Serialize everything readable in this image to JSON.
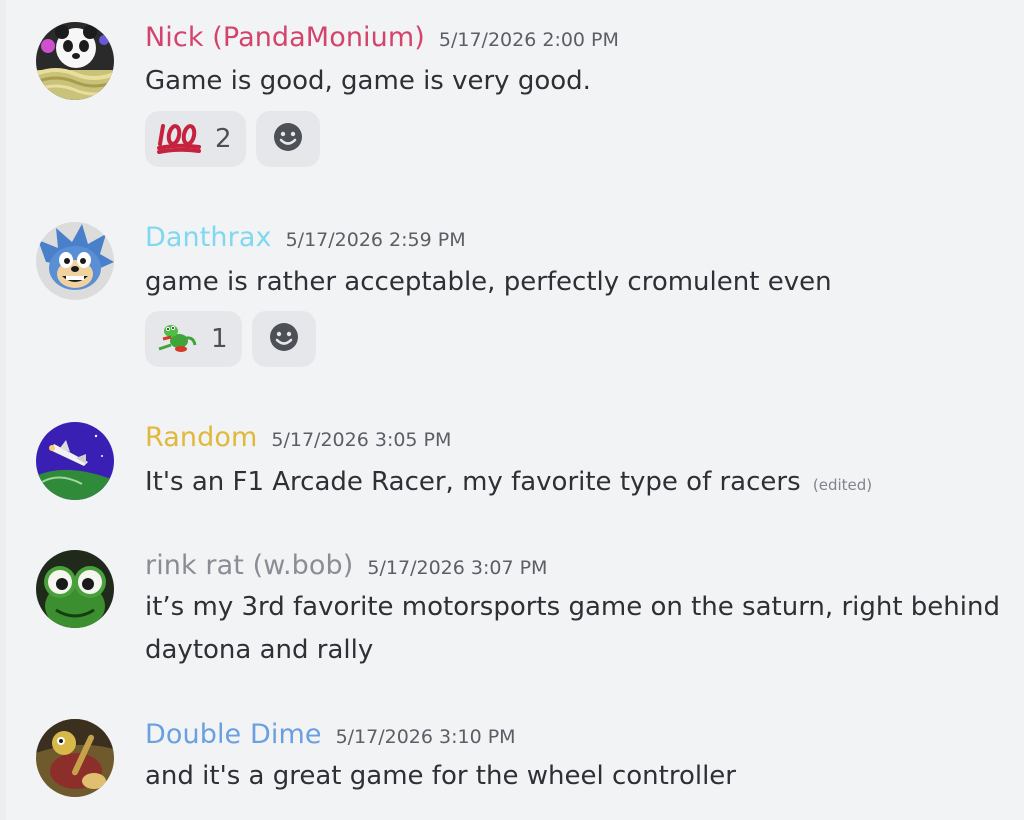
{
  "messages": [
    {
      "username": "Nick (PandaMonium)",
      "username_color": "#d4436b",
      "timestamp": "5/17/2026 2:00 PM",
      "content": "Game is good, game is very good.",
      "avatar_icon": "panda-avatar-icon",
      "reactions": [
        {
          "emoji": "💯",
          "icon": "hundred-points-emoji-icon",
          "count": "2"
        }
      ],
      "add_reaction_icon": "smiley-add-reaction-icon"
    },
    {
      "username": "Danthrax",
      "username_color": "#7fd8f0",
      "timestamp": "5/17/2026 2:59 PM",
      "content": "game is rather acceptable, perfectly cromulent even",
      "avatar_icon": "sonic-avatar-icon",
      "reactions": [
        {
          "emoji": "",
          "icon": "gex-lizard-emoji-icon",
          "count": "1"
        }
      ],
      "add_reaction_icon": "smiley-add-reaction-icon"
    },
    {
      "username": "Random",
      "username_color": "#e0b83a",
      "timestamp": "5/17/2026 3:05 PM",
      "content": "It's an F1 Arcade Racer, my favorite type of racers",
      "edited": "(edited)",
      "avatar_icon": "space-shuttle-avatar-icon"
    },
    {
      "username": "rink rat (w.bob)",
      "username_color": "#8a8d95",
      "timestamp": "5/17/2026 3:07 PM",
      "content": "it’s my 3rd favorite motorsports game on the saturn, right behind daytona and rally",
      "avatar_icon": "frog-avatar-icon"
    },
    {
      "username": "Double Dime",
      "username_color": "#6a9fe0",
      "timestamp": "5/17/2026 3:10 PM",
      "content": "and it's a great game for the wheel controller",
      "avatar_icon": "cartoon-avatar-icon"
    }
  ]
}
